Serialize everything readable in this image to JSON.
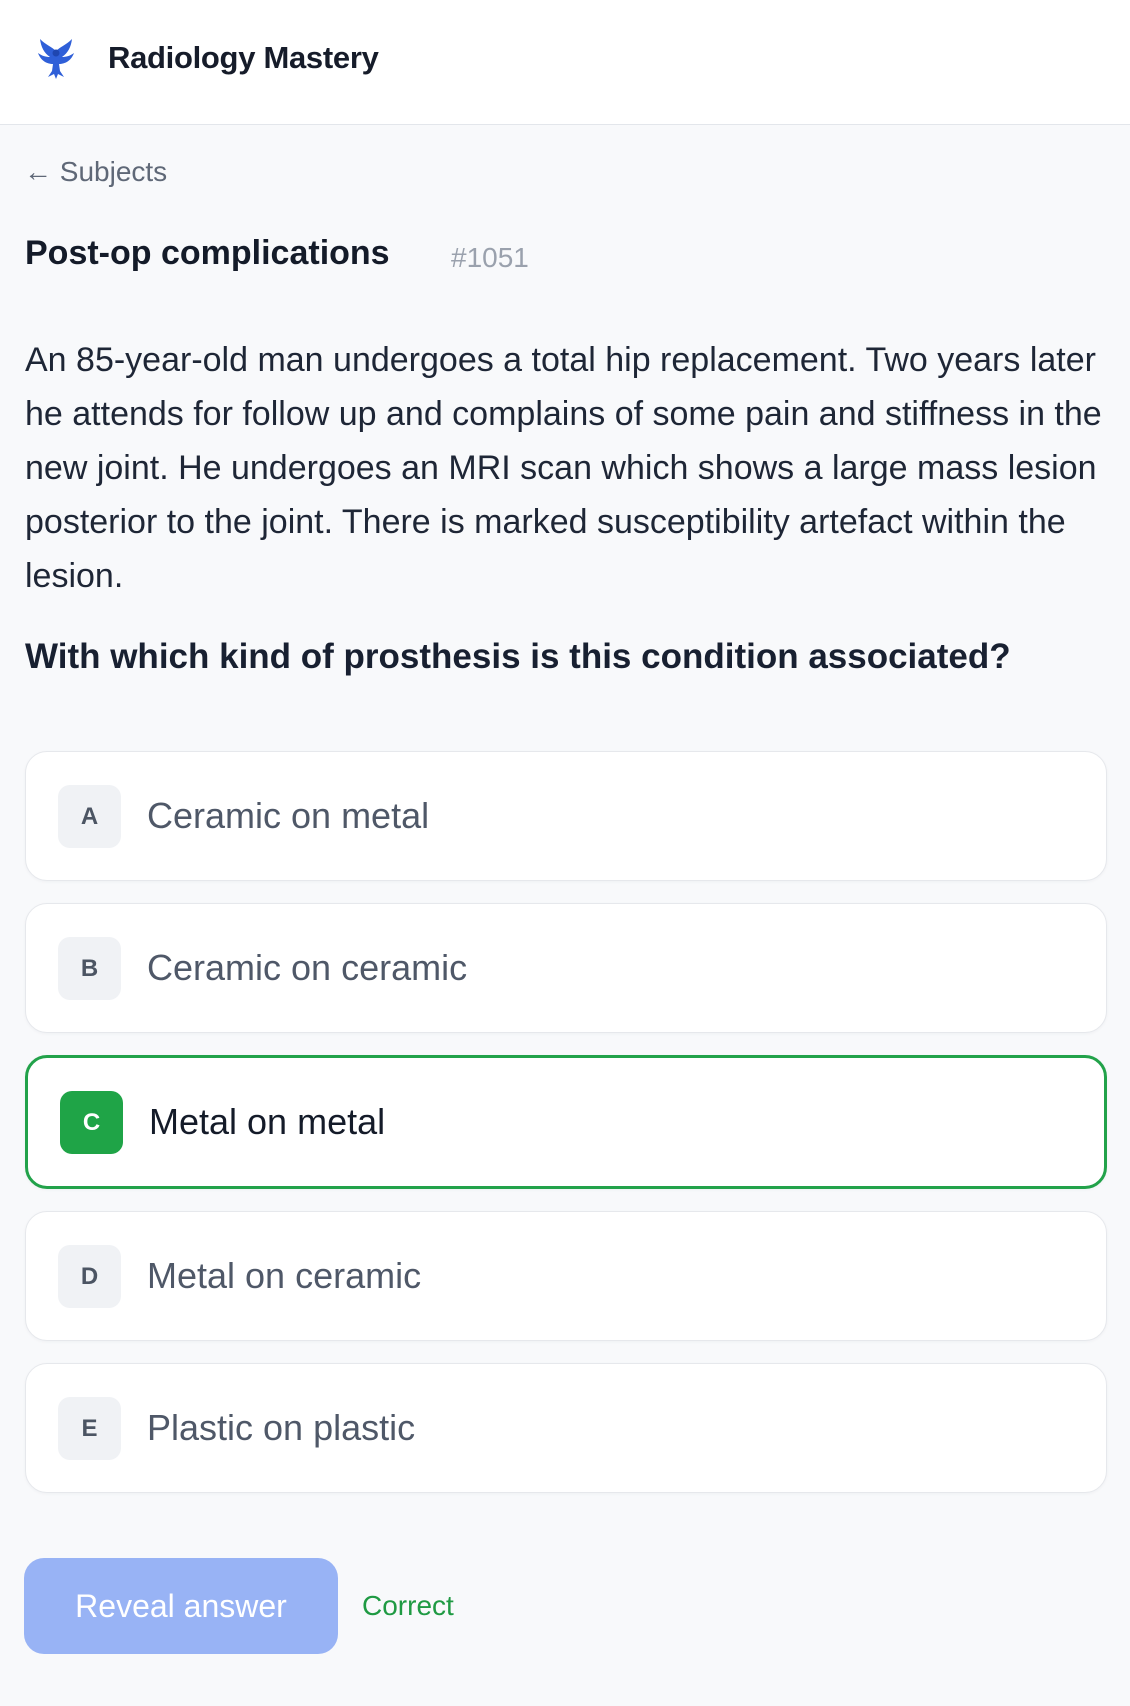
{
  "header": {
    "brand": "Radiology Mastery",
    "logo_icon": "eagle-logo-icon",
    "accent_color": "#2f5fd8"
  },
  "nav": {
    "back_label": "← Subjects"
  },
  "question": {
    "title": "Post-op complications",
    "id": "#1051",
    "stem": "An 85-year-old man undergoes a total hip replacement. Two years later he attends for follow up and complains of some pain and stiffness in the new joint. He undergoes an MRI scan which shows a large mass lesion posterior to the joint. There is marked susceptibility artefact within the lesion.",
    "prompt": "With which kind of prosthesis is this condition associated?"
  },
  "options": [
    {
      "letter": "A",
      "text": "Ceramic on metal",
      "selected": false
    },
    {
      "letter": "B",
      "text": "Ceramic on ceramic",
      "selected": false
    },
    {
      "letter": "C",
      "text": "Metal on metal",
      "selected": true
    },
    {
      "letter": "D",
      "text": "Metal on ceramic",
      "selected": false
    },
    {
      "letter": "E",
      "text": "Plastic on plastic",
      "selected": false
    }
  ],
  "actions": {
    "reveal_label": "Reveal answer",
    "feedback": "Correct",
    "selected_color": "#1fa447",
    "reveal_color": "#98b3f5"
  }
}
